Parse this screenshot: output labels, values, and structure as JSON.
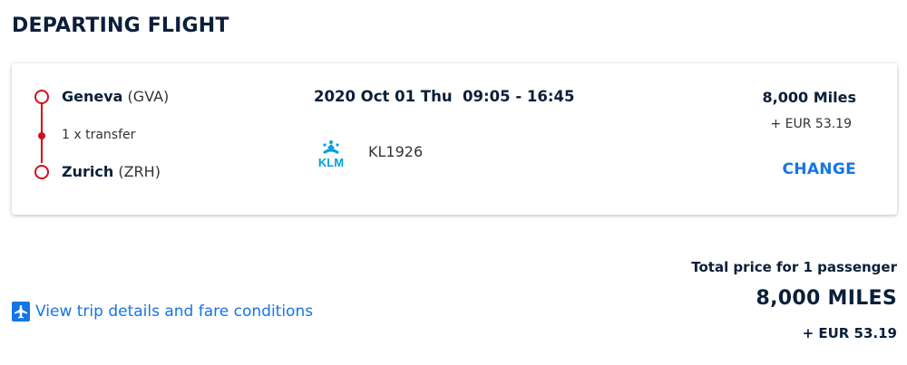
{
  "section_title": "DEPARTING FLIGHT",
  "flight": {
    "origin": {
      "city": "Geneva",
      "code": "(GVA)"
    },
    "transfer": "1 x transfer",
    "destination": {
      "city": "Zurich",
      "code": "(ZRH)"
    },
    "datetime": "2020 Oct 01 Thu  09:05 - 16:45",
    "airline_logo_text": "KLM",
    "airline_icon": "klm-crown-logo",
    "flight_number": "KL1926",
    "price_miles": "8,000 Miles",
    "price_eur": "+ EUR 53.19",
    "change_label": "CHANGE"
  },
  "footer": {
    "trip_link_icon": "airplane-icon",
    "trip_link_label": "View trip details and fare conditions",
    "total_label": "Total price for 1 passenger",
    "total_miles": "8,000 MILES",
    "total_eur": "+ EUR 53.19"
  },
  "colors": {
    "route_red": "#d0101b",
    "link_blue": "#1575e6",
    "klm_blue": "#00a1de",
    "text_dark": "#0b1f3a"
  }
}
